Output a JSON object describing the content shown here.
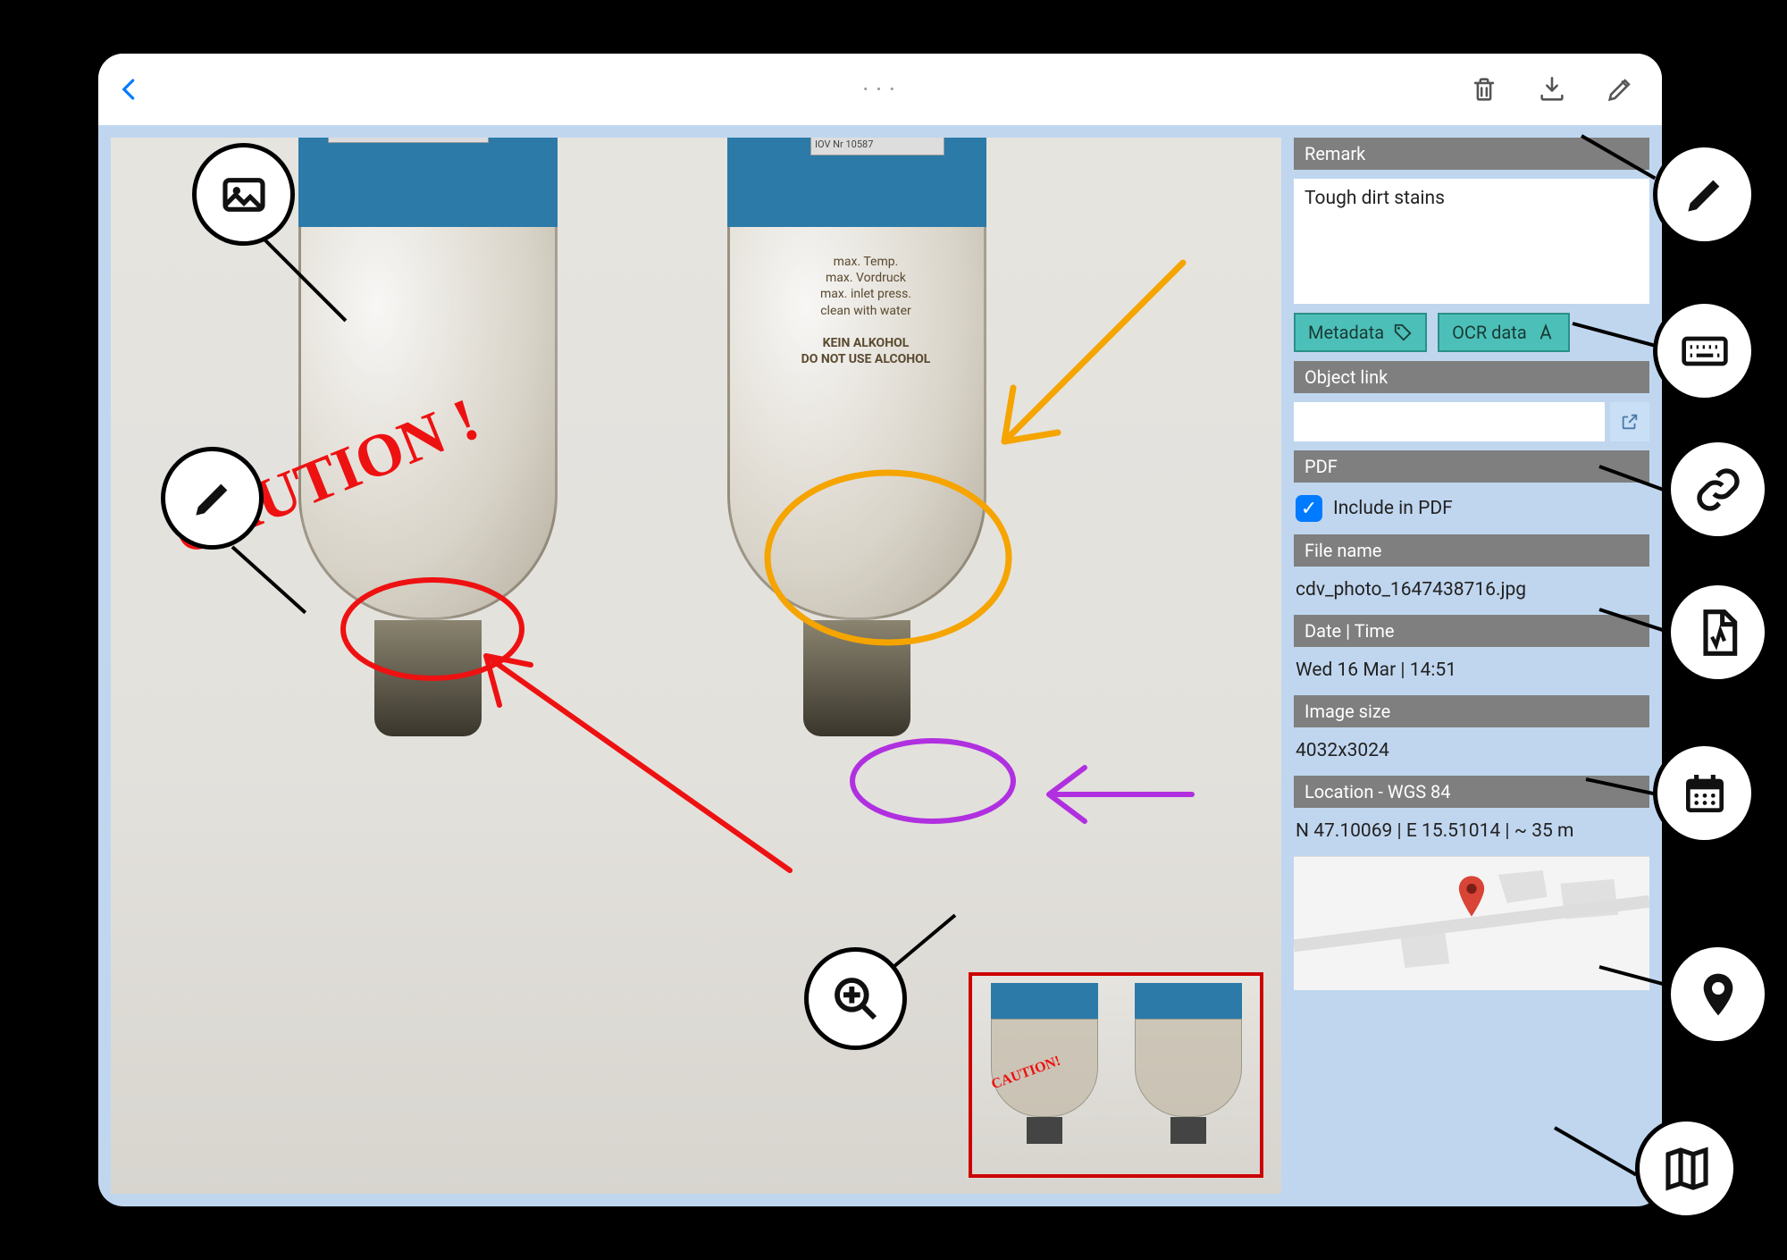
{
  "sidebar": {
    "remark_header": "Remark",
    "remark_text": "Tough dirt stains",
    "metadata_label": "Metadata",
    "ocr_label": "OCR data",
    "objectlink_header": "Object link",
    "pdf_header": "PDF",
    "pdf_checkbox_label": "Include in PDF",
    "filename_header": "File name",
    "filename_value": "cdv_photo_1647438716.jpg",
    "datetime_header": "Date | Time",
    "datetime_value": "Wed 16 Mar | 14:51",
    "imagesize_header": "Image size",
    "imagesize_value": "4032x3024",
    "location_header": "Location - WGS 84",
    "location_value": "N 47.10069 | E 15.51014 | ~ 35 m"
  },
  "annotations": {
    "caution": "CAUTION !",
    "label1": "KEIN ALKOHOL",
    "label2": "DO NOT USE ALCOHOL",
    "label3": "max. Temp.",
    "label4": "max. Vordruck",
    "label5": "max. inlet press.",
    "label6": "clean with water"
  }
}
